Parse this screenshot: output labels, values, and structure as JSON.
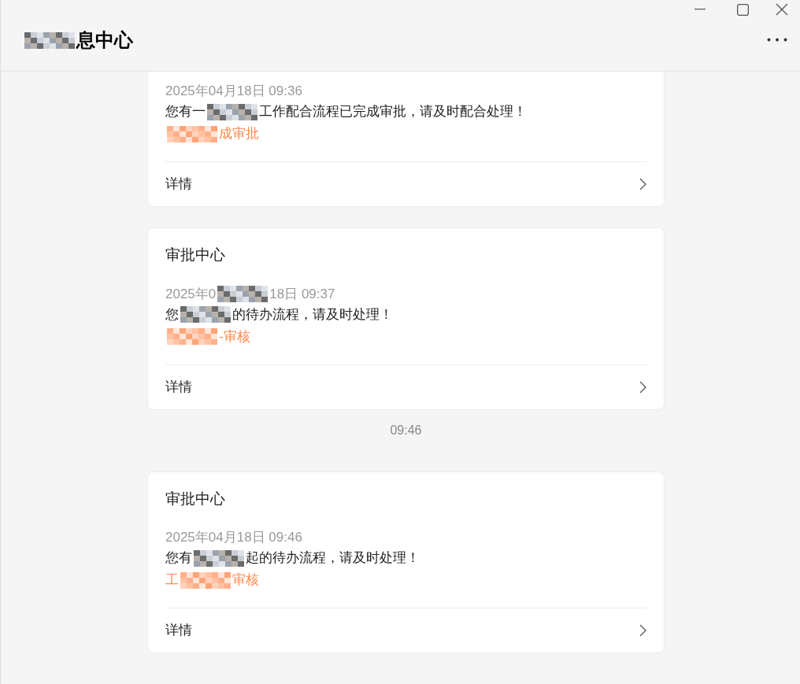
{
  "window": {
    "title_parts": [
      {
        "kind": "redacted"
      },
      {
        "kind": "text",
        "text": "息中心"
      }
    ]
  },
  "messages": [
    {
      "date_parts": [
        {
          "kind": "text",
          "text": "2025年04月18日 09:36"
        }
      ],
      "body_parts": [
        {
          "kind": "text",
          "text": "您有一"
        },
        {
          "kind": "redacted"
        },
        {
          "kind": "text",
          "text": "工作配合流程已完成审批，请及时配合处理！"
        }
      ],
      "link_parts": [
        {
          "kind": "redacted"
        },
        {
          "kind": "text",
          "text": "成审批"
        }
      ],
      "action": "详情"
    },
    {
      "title": "审批中心",
      "date_parts": [
        {
          "kind": "text",
          "text": "2025年0"
        },
        {
          "kind": "redacted"
        },
        {
          "kind": "text",
          "text": "18日 09:37"
        }
      ],
      "body_parts": [
        {
          "kind": "text",
          "text": "您"
        },
        {
          "kind": "redacted"
        },
        {
          "kind": "text",
          "text": "的待办流程，请及时处理！"
        }
      ],
      "link_parts": [
        {
          "kind": "redacted"
        },
        {
          "kind": "text",
          "text": "-审核"
        }
      ],
      "action": "详情"
    },
    {
      "time_divider": "09:46",
      "title": "审批中心",
      "date_parts": [
        {
          "kind": "text",
          "text": "2025年04月18日 09:46"
        }
      ],
      "body_parts": [
        {
          "kind": "text",
          "text": "您有"
        },
        {
          "kind": "redacted"
        },
        {
          "kind": "text",
          "text": "起的待办流程，请及时处理！"
        }
      ],
      "link_parts": [
        {
          "kind": "text",
          "text": "工"
        },
        {
          "kind": "redacted"
        },
        {
          "kind": "text",
          "text": "审核"
        }
      ],
      "action": "详情"
    }
  ]
}
